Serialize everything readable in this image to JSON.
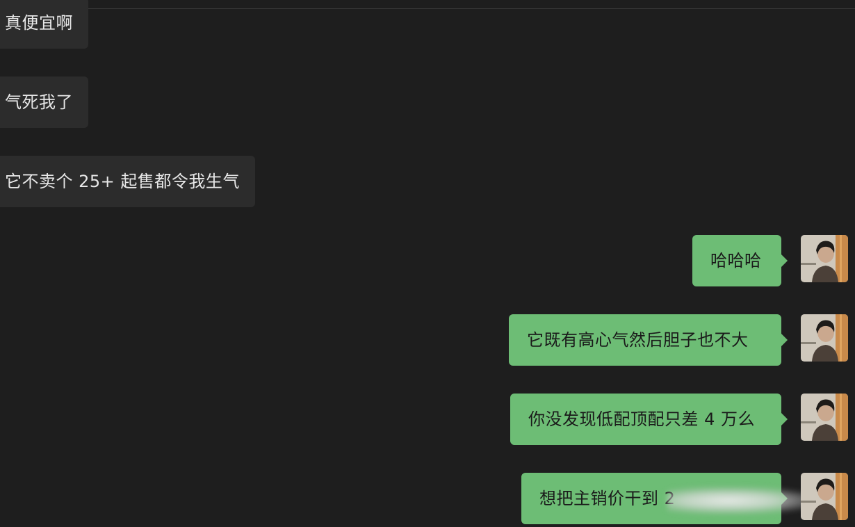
{
  "incoming": [
    {
      "text": "真便宜啊"
    },
    {
      "text": "气死我了"
    },
    {
      "text": "它不卖个 25+ 起售都令我生气"
    }
  ],
  "outgoing": [
    {
      "text": "哈哈哈"
    },
    {
      "text": "它既有高心气然后胆子也不大"
    },
    {
      "text": "你没发现低配顶配只差 4 万么"
    },
    {
      "text": "想把主销价干到 2"
    }
  ],
  "colors": {
    "background": "#1e1e1e",
    "incoming_bubble": "#2c2c2c",
    "outgoing_bubble": "#6dbd75"
  },
  "avatar_icon": "user-avatar-icon"
}
